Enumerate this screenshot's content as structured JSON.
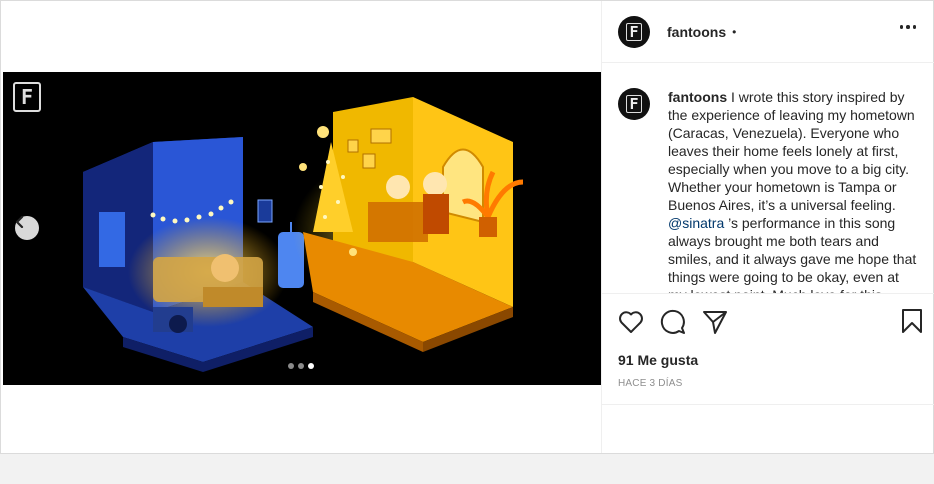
{
  "post": {
    "username": "fantoons",
    "separator": "•",
    "watermark_letter": "F",
    "avatar_letter": "F",
    "caption_user": "fantoons",
    "caption_before_mention": " I wrote this story inspired by the experience of leaving my hometown (Caracas, Venezuela). Everyone who leaves their home feels lonely at first, especially when you move to a big city. Whether your hometown is Tampa or Buenos Aires, it’s a universal feeling. ",
    "mention": "@sinatra",
    "caption_after_mention": " ’s performance in this song always brought me both tears and smiles, and it always gave me hope that things were going to be okay, even at my lowest point. Much love for this video.",
    "likes": "91 Me gusta",
    "time": "HACE 3 DÍAS"
  },
  "carousel": {
    "total": 3,
    "active": 3
  },
  "icons": [
    "chevron-left-icon",
    "more-icon",
    "heart-icon",
    "comment-icon",
    "share-icon",
    "bookmark-icon"
  ]
}
